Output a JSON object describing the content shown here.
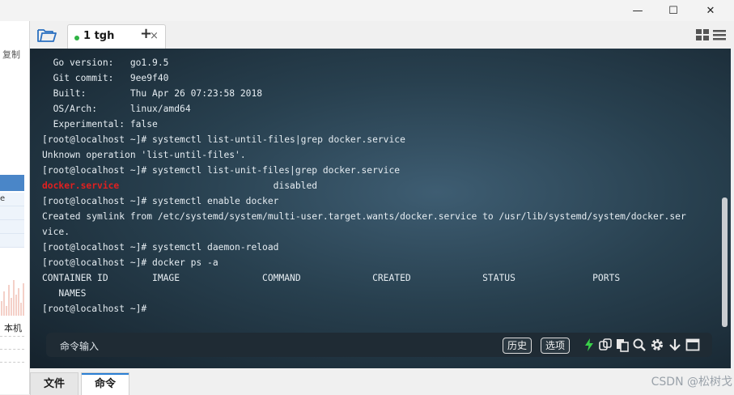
{
  "window": {
    "minimize_glyph": "—",
    "maximize_glyph": "☐",
    "close_glyph": "✕"
  },
  "left_panel": {
    "copy_label": "复制",
    "row_fragment": "e",
    "local_label": "本机"
  },
  "tabs": [
    {
      "label": "1 tgh",
      "status_color": "#2fb344",
      "close_glyph": "×"
    }
  ],
  "tab_add_glyph": "+",
  "terminal": {
    "lines": [
      [
        {
          "t": "  Go version:   go1.9.5"
        }
      ],
      [
        {
          "t": "  Git commit:   9ee9f40"
        }
      ],
      [
        {
          "t": "  Built:        Thu Apr 26 07:23:58 2018"
        }
      ],
      [
        {
          "t": "  OS/Arch:      linux/amd64"
        }
      ],
      [
        {
          "t": "  Experimental: false"
        }
      ],
      [
        {
          "t": "[root@localhost ~]# systemctl list-until-files|grep docker.service"
        }
      ],
      [
        {
          "t": "Unknown operation 'list-until-files'."
        }
      ],
      [
        {
          "t": "[root@localhost ~]# systemctl list-unit-files|grep docker.service"
        }
      ],
      [
        {
          "t": "docker.service",
          "c": "red"
        },
        {
          "t": "                            disabled"
        }
      ],
      [
        {
          "t": "[root@localhost ~]# systemctl enable docker"
        }
      ],
      [
        {
          "t": "Created symlink from /etc/systemd/system/multi-user.target.wants/docker.service to /usr/lib/systemd/system/docker.ser"
        }
      ],
      [
        {
          "t": "vice."
        }
      ],
      [
        {
          "t": "[root@localhost ~]# systemctl daemon-reload"
        }
      ],
      [
        {
          "t": "[root@localhost ~]# docker ps -a"
        }
      ],
      [
        {
          "t": "CONTAINER ID        IMAGE               COMMAND             CREATED             STATUS              PORTS"
        }
      ],
      [
        {
          "t": "   NAMES"
        }
      ],
      [
        {
          "t": "[root@localhost ~]# "
        }
      ]
    ]
  },
  "command_bar": {
    "label": "命令输入",
    "history_button": "历史",
    "options_button": "选项"
  },
  "bottom_tabs": {
    "files": "文件",
    "commands": "命令"
  },
  "watermark": "CSDN @松树戈",
  "resize_handle": "....",
  "colors": {
    "accent": "#2a7fd4",
    "command_highlight": "#e02020",
    "status_green": "#2fb344"
  }
}
